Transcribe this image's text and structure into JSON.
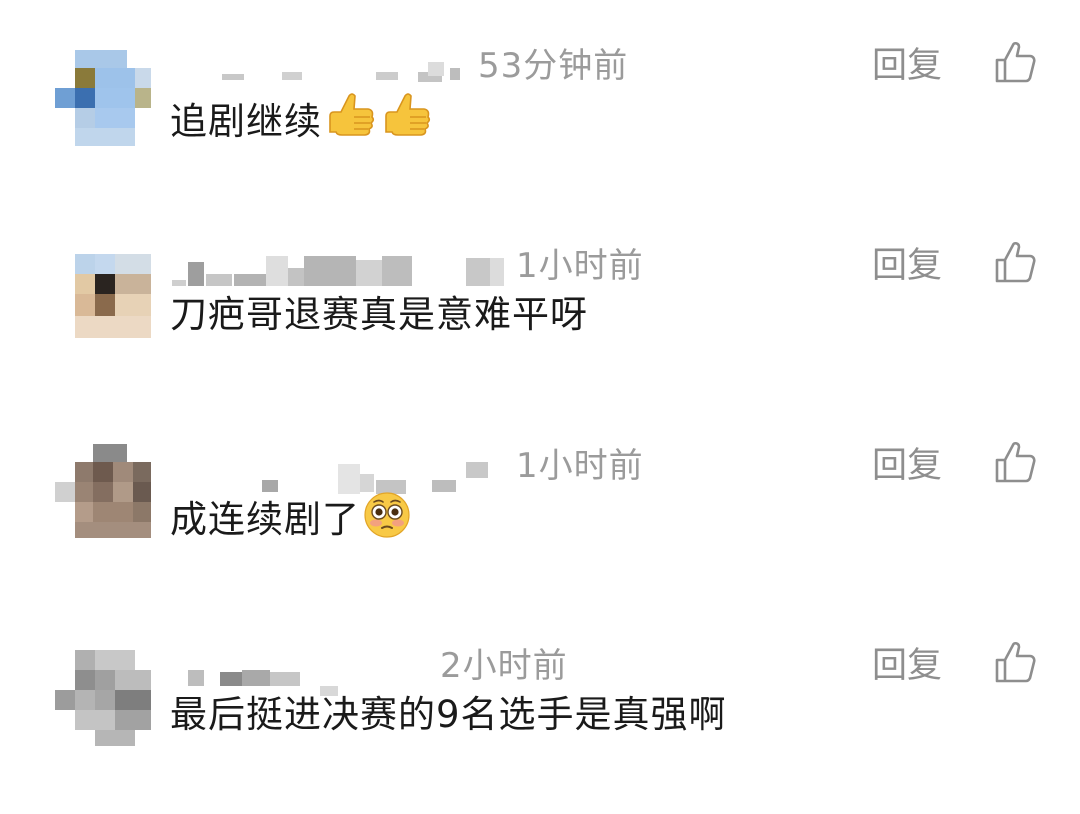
{
  "comments": [
    {
      "time": "53分钟前",
      "text": "追剧继续",
      "reply_label": "回复",
      "emojis": [
        "thumbs-up-emoji",
        "thumbs-up-emoji"
      ]
    },
    {
      "time": "1小时前",
      "text": "刀疤哥退赛真是意难平呀",
      "reply_label": "回复",
      "emojis": []
    },
    {
      "time": "1小时前",
      "text": "成连续剧了",
      "reply_label": "回复",
      "emojis": [
        "flushed-face-emoji"
      ]
    },
    {
      "time": "2小时前",
      "text": "最后挺进决赛的9名选手是真强啊",
      "reply_label": "回复",
      "emojis": []
    }
  ],
  "icons": {
    "like": "thumbs-up-outline-icon"
  },
  "colors": {
    "text": "#1a1a1a",
    "meta": "#9b9b9b",
    "background": "#ffffff"
  }
}
